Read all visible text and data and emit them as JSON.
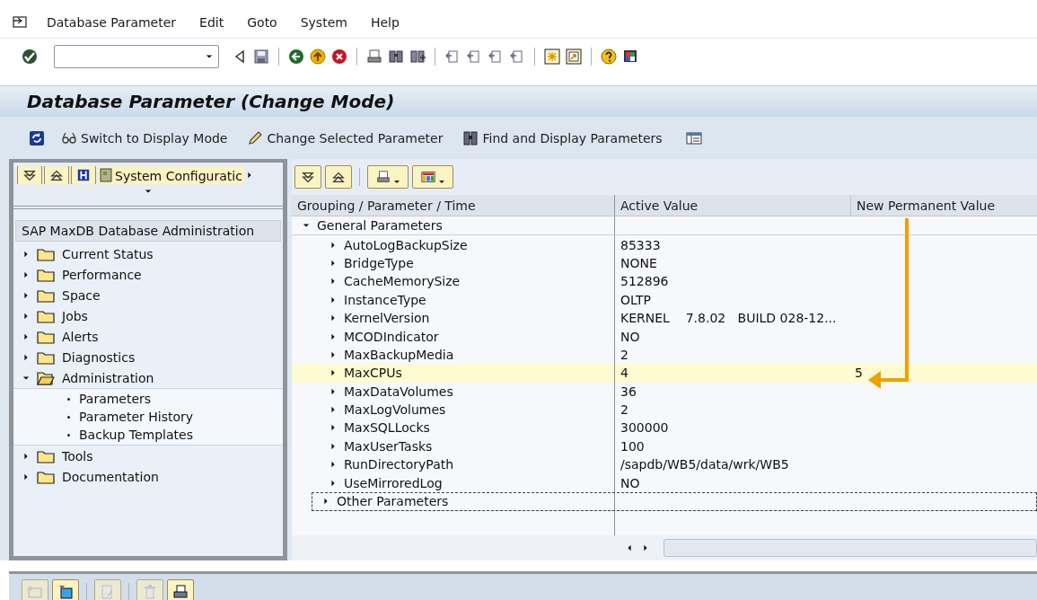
{
  "menu": [
    {
      "label": "Database Parameter"
    },
    {
      "label": "Edit"
    },
    {
      "label": "Goto"
    },
    {
      "label": "System"
    },
    {
      "label": "Help"
    }
  ],
  "title": "Database Parameter (Change Mode)",
  "app_toolbar": [
    {
      "kind": "refresh"
    },
    {
      "kind": "glasses",
      "label": "Switch to Display Mode"
    },
    {
      "kind": "pencil",
      "label": "Change Selected Parameter"
    },
    {
      "kind": "binoculars",
      "label": "Find and Display Parameters"
    },
    {
      "kind": "layout"
    }
  ],
  "left_panel": {
    "tab_label": "System Configuratic",
    "tree_header": "SAP MaxDB Database Administration",
    "tree": [
      {
        "label": "Current Status",
        "expanded": false
      },
      {
        "label": "Performance",
        "expanded": false
      },
      {
        "label": "Space",
        "expanded": false
      },
      {
        "label": "Jobs",
        "expanded": false
      },
      {
        "label": "Alerts",
        "expanded": false
      },
      {
        "label": "Diagnostics",
        "expanded": false
      },
      {
        "label": "Administration",
        "expanded": true,
        "children": [
          {
            "label": "Parameters"
          },
          {
            "label": "Parameter History"
          },
          {
            "label": "Backup Templates"
          }
        ]
      },
      {
        "label": "Tools",
        "expanded": false
      },
      {
        "label": "Documentation",
        "expanded": false
      }
    ]
  },
  "grid": {
    "columns": [
      "Grouping / Parameter / Time",
      "Active Value",
      "New Permanent Value"
    ],
    "groups": [
      {
        "label": "General Parameters",
        "expanded": true,
        "focused": false,
        "rows": [
          {
            "name": "AutoLogBackupSize",
            "active_value": "85333",
            "selected": false
          },
          {
            "name": "BridgeType",
            "active_value": "NONE",
            "selected": false
          },
          {
            "name": "CacheMemorySize",
            "active_value": "512896",
            "selected": false
          },
          {
            "name": "InstanceType",
            "active_value": "OLTP",
            "selected": false
          },
          {
            "name": "KernelVersion",
            "active_value": "KERNEL    7.8.02   BUILD 028-12...",
            "selected": false
          },
          {
            "name": "MCODIndicator",
            "active_value": "NO",
            "selected": false
          },
          {
            "name": "MaxBackupMedia",
            "active_value": "2",
            "selected": false
          },
          {
            "name": "MaxCPUs",
            "active_value": "4",
            "new_value": "5",
            "selected": true
          },
          {
            "name": "MaxDataVolumes",
            "active_value": "36",
            "selected": false
          },
          {
            "name": "MaxLogVolumes",
            "active_value": "2",
            "selected": false
          },
          {
            "name": "MaxSQLLocks",
            "active_value": "300000",
            "selected": false
          },
          {
            "name": "MaxUserTasks",
            "active_value": "100",
            "selected": false
          },
          {
            "name": "RunDirectoryPath",
            "active_value": "/sapdb/WB5/data/wrk/WB5",
            "selected": false
          },
          {
            "name": "UseMirroredLog",
            "active_value": "NO",
            "selected": false
          }
        ]
      },
      {
        "label": "Other Parameters",
        "expanded": false,
        "focused": true
      }
    ]
  }
}
